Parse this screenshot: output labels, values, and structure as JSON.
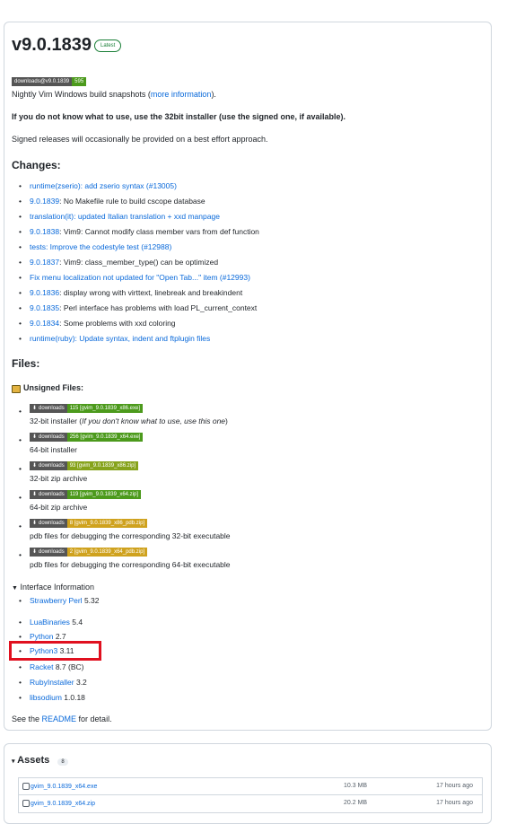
{
  "release": {
    "tag": "v9.0.1839",
    "latest_label": "Latest"
  },
  "top_badge": {
    "left": "downloads@v9.0.1839",
    "right": "595"
  },
  "intro": {
    "nightly_prefix": "Nightly Vim Windows build snapshots (",
    "nightly_link": "more information",
    "nightly_suffix": ").",
    "advice": "If you do not know what to use, use the 32bit installer (use the signed one, if available).",
    "signed": "Signed releases will occasionally be provided on a best effort approach."
  },
  "changes": {
    "heading": "Changes:",
    "items": [
      {
        "link": "runtime(zserio): add zserio syntax (#13005)",
        "text": ""
      },
      {
        "link": "9.0.1839",
        "text": ": No Makefile rule to build cscope database"
      },
      {
        "link": "translation(it): updated Italian translation + xxd manpage",
        "text": ""
      },
      {
        "link": "9.0.1838",
        "text": ": Vim9: Cannot modify class member vars from def function"
      },
      {
        "link": "tests: Improve the codestyle test (#12988)",
        "text": ""
      },
      {
        "link": "9.0.1837",
        "text": ": Vim9: class_member_type() can be optimized"
      },
      {
        "link": "Fix menu localization not updated for \"Open Tab...\" item (#12993)",
        "text": ""
      },
      {
        "link": "9.0.1836",
        "text": ": display wrong with virttext, linebreak and breakindent"
      },
      {
        "link": "9.0.1835",
        "text": ": Perl interface has problems with load PL_current_context"
      },
      {
        "link": "9.0.1834",
        "text": ": Some problems with xxd coloring"
      },
      {
        "link": "runtime(ruby): Update syntax, indent and ftplugin files",
        "text": ""
      }
    ]
  },
  "files": {
    "heading": "Files:",
    "unsigned_label": "Unsigned Files:",
    "items": [
      {
        "badge_left": "downloads",
        "badge_right": "115 [gvim_9.0.1839_x86.exe]",
        "color": "#4c9a1c",
        "desc_plain": "32-bit installer (",
        "desc_italic": "If you don't know what to use, use this one",
        "desc_end": ")"
      },
      {
        "badge_left": "downloads",
        "badge_right": "256 [gvim_9.0.1839_x64.exe]",
        "color": "#4c9a1c",
        "desc_plain": "64-bit installer",
        "desc_italic": "",
        "desc_end": ""
      },
      {
        "badge_left": "downloads",
        "badge_right": "93 [gvim_9.0.1839_x86.zip]",
        "color": "#86a31b",
        "desc_plain": "32-bit zip archive",
        "desc_italic": "",
        "desc_end": ""
      },
      {
        "badge_left": "downloads",
        "badge_right": "119 [gvim_9.0.1839_x64.zip]",
        "color": "#4c9a1c",
        "desc_plain": "64-bit zip archive",
        "desc_italic": "",
        "desc_end": ""
      },
      {
        "badge_left": "downloads",
        "badge_right": "8 [gvim_9.0.1839_x86_pdb.zip]",
        "color": "#cfa21e",
        "desc_plain": "pdb files for debugging the corresponding 32-bit executable",
        "desc_italic": "",
        "desc_end": ""
      },
      {
        "badge_left": "downloads",
        "badge_right": "2 [gvim_9.0.1839_x64_pdb.zip]",
        "color": "#cfa21e",
        "desc_plain": "pdb files for debugging the corresponding 64-bit executable",
        "desc_italic": "",
        "desc_end": ""
      }
    ]
  },
  "interface": {
    "summary": "Interface Information",
    "items": [
      {
        "link": "Strawberry Perl",
        "ver": " 5.32"
      },
      {
        "link": "LuaBinaries",
        "ver": " 5.4"
      },
      {
        "link": "Python",
        "ver": " 2.7"
      },
      {
        "link": "Python3",
        "ver": " 3.11"
      },
      {
        "link": "Racket",
        "ver": " 8.7 (BC)"
      },
      {
        "link": "RubyInstaller",
        "ver": " 3.2"
      },
      {
        "link": "libsodium",
        "ver": " 1.0.18"
      }
    ],
    "readme_prefix": "See the ",
    "readme_link": "README",
    "readme_suffix": " for detail."
  },
  "assets": {
    "heading": "Assets",
    "count": "8",
    "rows": [
      {
        "name": "gvim_9.0.1839_x64.exe",
        "size": "10.3 MB",
        "time": "17 hours ago"
      },
      {
        "name": "gvim_9.0.1839_x64.zip",
        "size": "20.2 MB",
        "time": "17 hours ago"
      }
    ]
  },
  "colors": {
    "link": "#0969da",
    "highlight": "#e0101f",
    "top_badge_green": "#4c9a1c"
  }
}
